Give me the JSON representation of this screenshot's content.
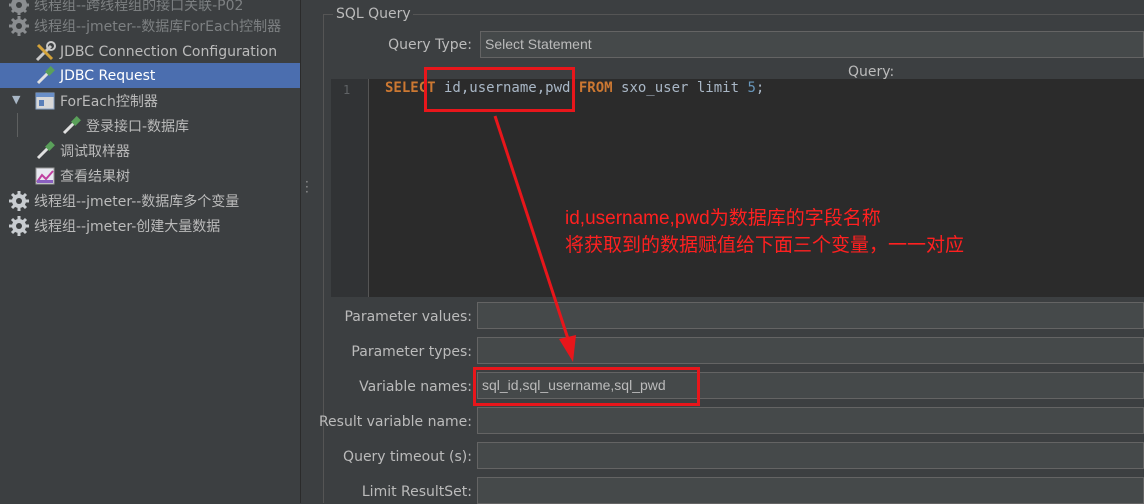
{
  "tree": {
    "items": [
      {
        "label": "线程组--跨线程组的接口关联-P02",
        "icon": "gear-icon"
      },
      {
        "label": "线程组--jmeter--数据库ForEach控制器",
        "icon": "gear-icon"
      },
      {
        "label": "JDBC Connection Configuration",
        "icon": "wrench-icon"
      },
      {
        "label": "JDBC Request",
        "icon": "pipette-icon"
      },
      {
        "label": "ForEach控制器",
        "icon": "controller-icon"
      },
      {
        "label": "登录接口-数据库",
        "icon": "pipette-icon"
      },
      {
        "label": "调试取样器",
        "icon": "pipette-icon"
      },
      {
        "label": "查看结果树",
        "icon": "chart-icon"
      },
      {
        "label": "线程组--jmeter--数据库多个变量",
        "icon": "gear-icon"
      },
      {
        "label": "线程组--jmeter-创建大量数据",
        "icon": "gear-icon"
      }
    ]
  },
  "panel": {
    "group_title": "SQL Query",
    "query_type_label": "Query Type:",
    "query_type_value": "Select Statement",
    "query_label": "Query:",
    "line_number": "1",
    "code": {
      "select": "SELECT",
      "fields": " id,username,pwd ",
      "from": "FROM",
      "rest": " sxo_user limit ",
      "limit": "5",
      "end": ";"
    },
    "fields": {
      "parameter_values_label": "Parameter values:",
      "parameter_values": "",
      "parameter_types_label": "Parameter types:",
      "parameter_types": "",
      "variable_names_label": "Variable names:",
      "variable_names": "sql_id,sql_username,sql_pwd",
      "result_variable_label": "Result variable name:",
      "result_variable": "",
      "query_timeout_label": "Query timeout (s):",
      "query_timeout": "",
      "limit_resultset_label": "Limit ResultSet:",
      "limit_resultset": ""
    }
  },
  "annotation": {
    "line1": "id,username,pwd为数据库的字段名称",
    "line2": "将获取到的数据赋值给下面三个变量，一一对应",
    "color": "#e8161b"
  }
}
